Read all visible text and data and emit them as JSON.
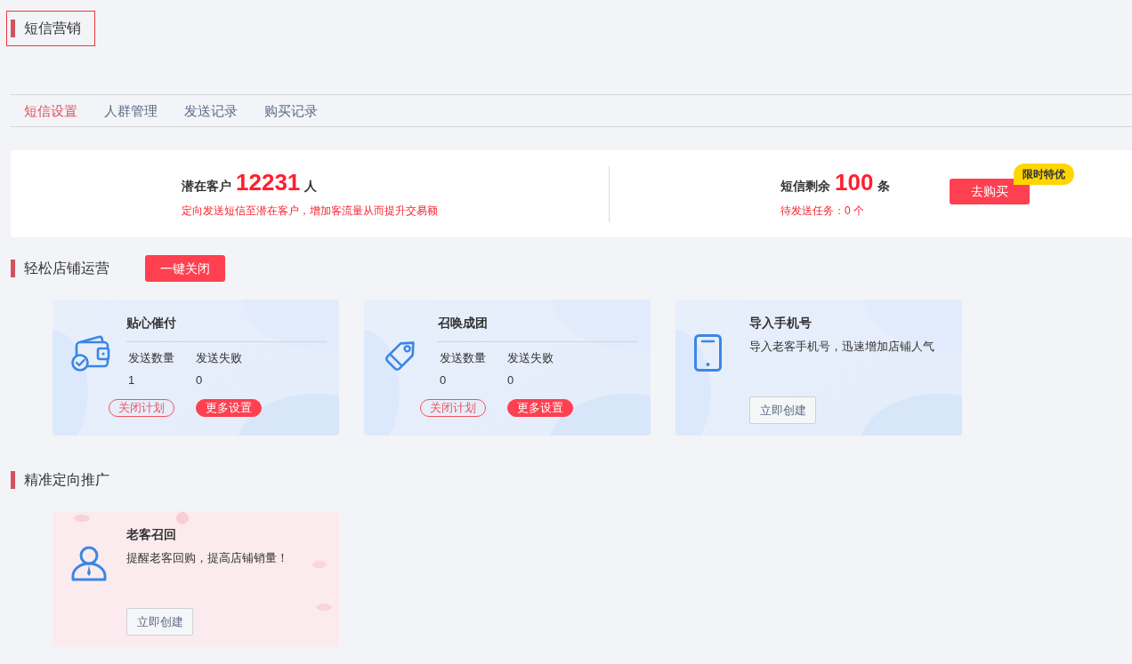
{
  "page_title": "短信营销",
  "tabs": [
    {
      "label": "短信设置",
      "selected": true
    },
    {
      "label": "人群管理",
      "selected": false
    },
    {
      "label": "发送记录",
      "selected": false
    },
    {
      "label": "购买记录",
      "selected": false
    }
  ],
  "summary": {
    "stats": [
      {
        "label": "潜在客户",
        "count": "12231",
        "unit": "人",
        "note": "定向发送短信至潜在客户，增加客流量从而提升交易额"
      },
      {
        "label": "短信剩余",
        "count": "100",
        "unit": "条",
        "note": "待发送任务：0 个"
      }
    ],
    "buy_button": "去购买",
    "promo_badge": "限时特优"
  },
  "sections": [
    {
      "title": "轻松店铺运营",
      "action_button": "一键关闭",
      "cards": [
        {
          "kind": "stats",
          "title": "贴心催付",
          "stats": [
            {
              "label": "发送数量",
              "value": "1"
            },
            {
              "label": "发送失败",
              "value": "0"
            }
          ],
          "buttons": [
            {
              "kind": "outline",
              "label": "关闭计划"
            },
            {
              "kind": "filled",
              "label": "更多设置"
            }
          ]
        },
        {
          "kind": "stats",
          "title": "召唤成团",
          "stats": [
            {
              "label": "发送数量",
              "value": "0"
            },
            {
              "label": "发送失败",
              "value": "0"
            }
          ],
          "buttons": [
            {
              "kind": "outline",
              "label": "关闭计划"
            },
            {
              "kind": "filled",
              "label": "更多设置"
            }
          ]
        },
        {
          "kind": "create",
          "title": "导入手机号",
          "description": "导入老客手机号，迅速增加店铺人气",
          "buttons": [
            {
              "kind": "plain",
              "label": "立即创建"
            }
          ]
        }
      ]
    },
    {
      "title": "精准定向推广",
      "cards": [
        {
          "kind": "create",
          "title": "老客召回",
          "description": "提醒老客回购，提高店铺销量！",
          "buttons": [
            {
              "kind": "plain",
              "label": "立即创建"
            }
          ]
        }
      ]
    }
  ]
}
